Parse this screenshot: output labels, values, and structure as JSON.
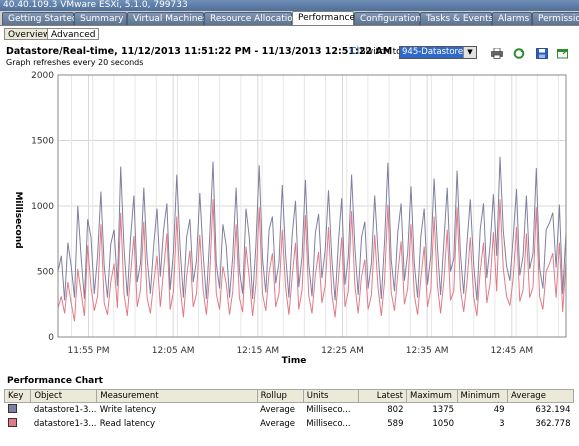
{
  "window": {
    "title": "40.40.109.3 VMware ESXi, 5.1.0, 799733"
  },
  "tabs": [
    {
      "label": "Getting Started"
    },
    {
      "label": "Summary"
    },
    {
      "label": "Virtual Machines"
    },
    {
      "label": "Resource Allocation"
    },
    {
      "label": "Performance",
      "active": true
    },
    {
      "label": "Configuration"
    },
    {
      "label": "Tasks & Events"
    },
    {
      "label": "Alarms"
    },
    {
      "label": "Permissio"
    }
  ],
  "subtabs": [
    {
      "label": "Overview"
    },
    {
      "label": "Advanced",
      "active": true
    }
  ],
  "header": {
    "title": "Datastore/Real-time, 11/12/2013 11:51:22 PM - 11/13/2013 12:51:22 AM",
    "subtitle": "Graph refreshes every 20 seconds",
    "chart_options_link": "Cl",
    "switch_label": "Switch to:",
    "switch_value": "945-Datastore"
  },
  "toolbar": [
    "print-icon",
    "refresh-icon",
    "save-icon",
    "popout-icon"
  ],
  "colors": {
    "write": "#7f7fa0",
    "read": "#e07b86",
    "grid": "#d8d8d8"
  },
  "chart_data": {
    "type": "line",
    "xlabel": "Time",
    "ylabel": "Millisecond",
    "ylim": [
      0,
      2000
    ],
    "yticks": [
      0,
      500,
      1000,
      1500,
      2000
    ],
    "x_tick_labels": [
      "11:55 PM",
      "12:05 AM",
      "12:15 AM",
      "12:25 AM",
      "12:35 AM",
      "12:45 AM"
    ],
    "x_tick_minutes": [
      3.6,
      13.6,
      23.6,
      33.6,
      43.6,
      53.6
    ],
    "x_range_minutes": [
      0,
      60
    ],
    "series": [
      {
        "name": "Write latency",
        "color": "#7f7fa0",
        "values": [
          500,
          620,
          280,
          720,
          540,
          300,
          1000,
          610,
          290,
          900,
          760,
          330,
          620,
          1110,
          540,
          300,
          710,
          820,
          390,
          1300,
          680,
          310,
          760,
          1080,
          420,
          560,
          1140,
          600,
          330,
          700,
          980,
          460,
          820,
          1020,
          360,
          650,
          1240,
          680,
          300,
          760,
          900,
          420,
          580,
          1100,
          640,
          290,
          760,
          1340,
          560,
          370,
          860,
          700,
          300,
          620,
          1140,
          510,
          330,
          980,
          760,
          290,
          700,
          1310,
          600,
          340,
          820,
          920,
          410,
          570,
          1160,
          630,
          300,
          780,
          1040,
          380,
          620,
          1200,
          560,
          310,
          790,
          940,
          450,
          660,
          1120,
          600,
          280,
          720,
          1060,
          400,
          610,
          1240,
          680,
          320,
          760,
          880,
          370,
          560,
          1080,
          650,
          290,
          730,
          1330,
          590,
          350,
          800,
          1020,
          430,
          640,
          1150,
          560,
          300,
          770,
          980,
          400,
          620,
          1210,
          690,
          320,
          730,
          1140,
          500,
          600,
          1270,
          640,
          330,
          720,
          1050,
          560,
          280,
          820,
          1020,
          450,
          700,
          1090,
          620,
          1375,
          810,
          540,
          430,
          760,
          1130,
          470,
          620,
          1080,
          520,
          640,
          1290,
          530,
          370,
          820,
          870,
          950,
          530,
          1010,
          330,
          802
        ]
      },
      {
        "name": "Read latency",
        "color": "#e07b86",
        "values": [
          220,
          310,
          180,
          420,
          260,
          120,
          520,
          340,
          160,
          700,
          380,
          200,
          310,
          860,
          260,
          170,
          420,
          560,
          220,
          950,
          330,
          160,
          480,
          770,
          230,
          360,
          880,
          300,
          180,
          420,
          620,
          230,
          510,
          790,
          210,
          350,
          920,
          380,
          150,
          460,
          660,
          230,
          330,
          780,
          360,
          170,
          470,
          1050,
          330,
          210,
          540,
          410,
          170,
          350,
          860,
          300,
          190,
          690,
          450,
          160,
          400,
          990,
          330,
          200,
          490,
          640,
          230,
          330,
          820,
          380,
          170,
          460,
          720,
          210,
          360,
          930,
          320,
          180,
          470,
          650,
          260,
          390,
          840,
          330,
          150,
          440,
          760,
          230,
          350,
          960,
          390,
          180,
          460,
          590,
          210,
          320,
          780,
          380,
          160,
          430,
          1010,
          340,
          200,
          480,
          730,
          250,
          370,
          860,
          320,
          170,
          450,
          690,
          230,
          360,
          920,
          400,
          180,
          430,
          820,
          280,
          350,
          990,
          370,
          190,
          420,
          760,
          310,
          160,
          500,
          720,
          260,
          410,
          800,
          350,
          1050,
          520,
          310,
          240,
          450,
          840,
          270,
          360,
          790,
          300,
          380,
          990,
          310,
          210,
          500,
          560,
          640,
          300,
          720,
          190,
          589
        ]
      }
    ]
  },
  "perf_chart": {
    "title": "Performance Chart",
    "columns": [
      "Key",
      "Object",
      "Measurement",
      "Rollup",
      "Units",
      "Latest",
      "Maximum",
      "Minimum",
      "Average"
    ],
    "rows": [
      {
        "key_color": "#7f7fa0",
        "object": "datastore1-3...",
        "measurement": "Write latency",
        "rollup": "Average",
        "units": "Milliseco...",
        "latest": "802",
        "maximum": "1375",
        "minimum": "49",
        "average": "632.194"
      },
      {
        "key_color": "#e07b86",
        "object": "datastore1-3...",
        "measurement": "Read latency",
        "rollup": "Average",
        "units": "Milliseco...",
        "latest": "589",
        "maximum": "1050",
        "minimum": "3",
        "average": "362.778"
      }
    ]
  }
}
